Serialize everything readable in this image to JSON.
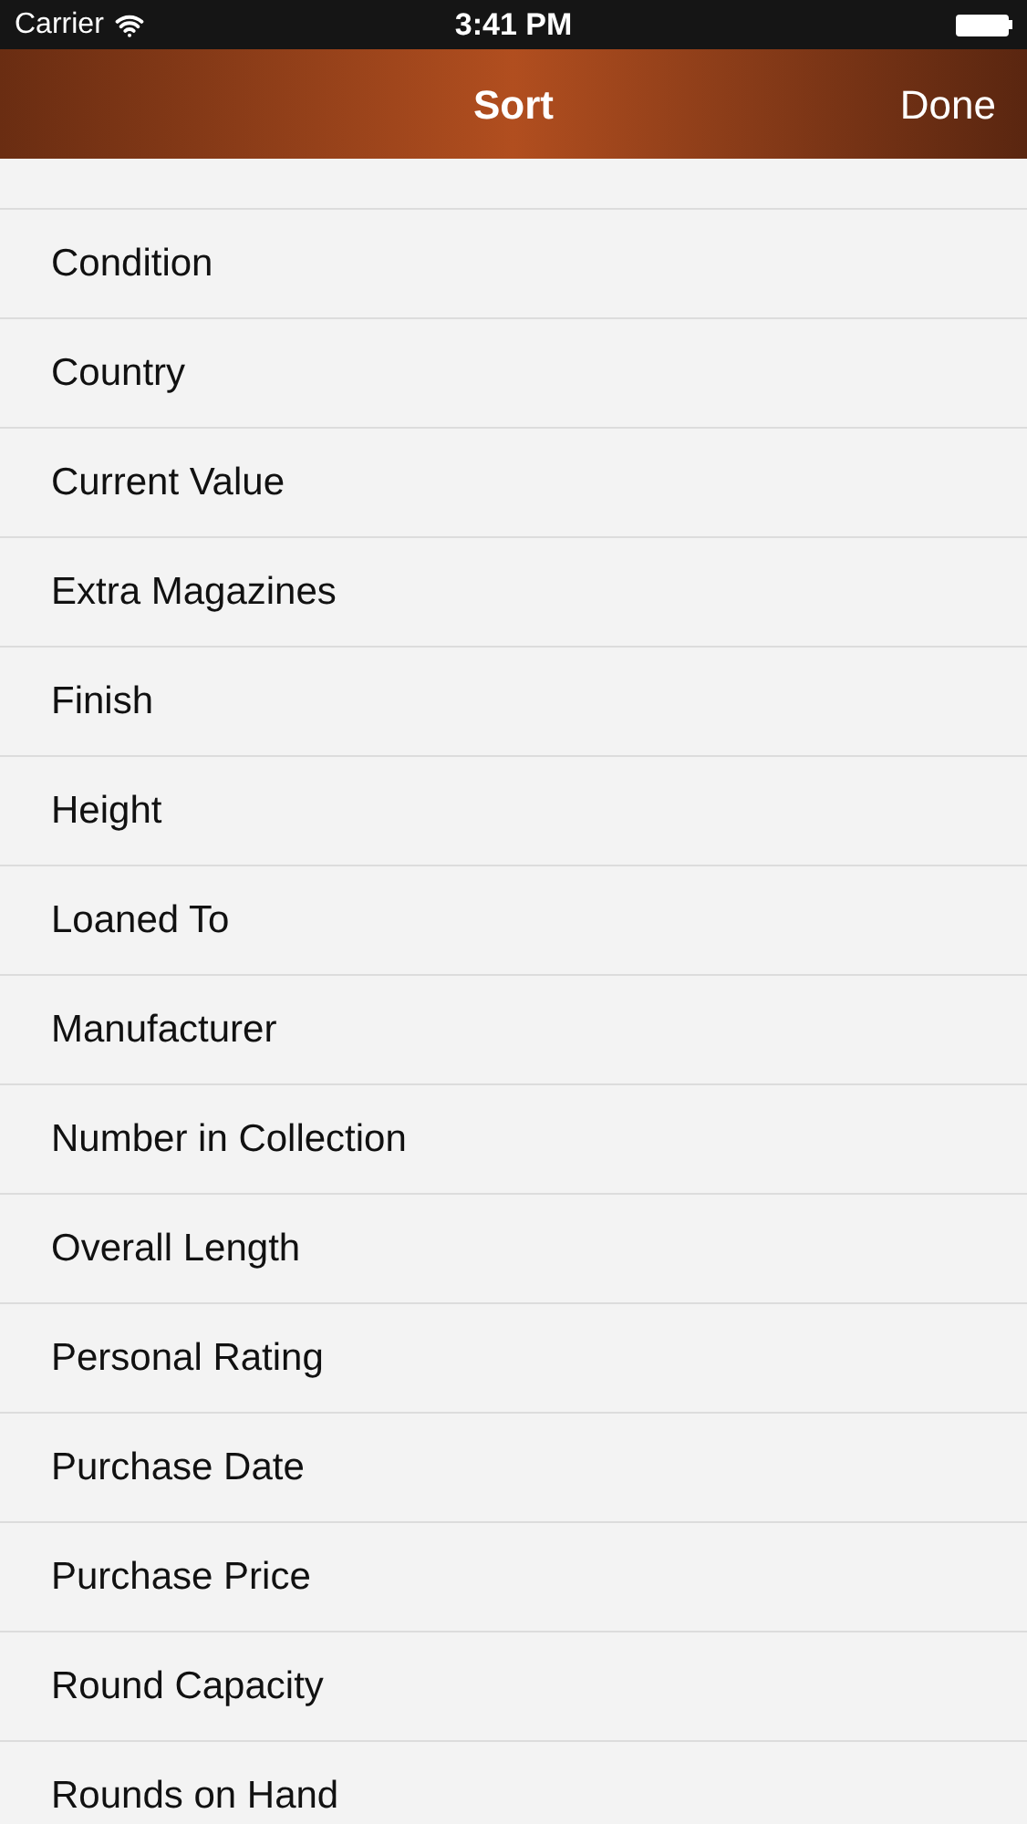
{
  "status_bar": {
    "carrier": "Carrier",
    "time": "3:41 PM"
  },
  "nav_bar": {
    "title": "Sort",
    "done": "Done"
  },
  "items": [
    "Condition",
    "Country",
    "Current Value",
    "Extra Magazines",
    "Finish",
    "Height",
    "Loaned To",
    "Manufacturer",
    "Number in Collection",
    "Overall Length",
    "Personal Rating",
    "Purchase Date",
    "Purchase Price",
    "Round Capacity",
    "Rounds on Hand"
  ]
}
